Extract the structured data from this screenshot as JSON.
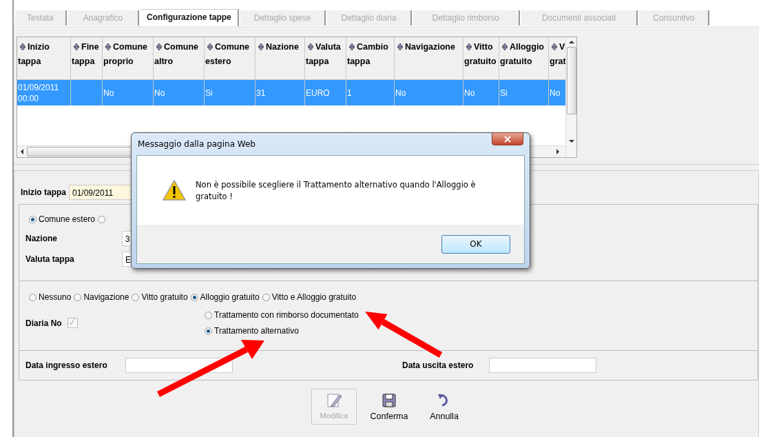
{
  "tabs": [
    {
      "label": "Testata",
      "selected": false
    },
    {
      "label": "Anagrafico",
      "selected": false
    },
    {
      "label": "Configurazione tappe",
      "selected": true
    },
    {
      "label": "Dettaglio spese",
      "selected": false
    },
    {
      "label": "Dettaglio diaria",
      "selected": false
    },
    {
      "label": "Dettaglio rimborso",
      "selected": false
    },
    {
      "label": "Documenti associati",
      "selected": false
    },
    {
      "label": "Consuntivo",
      "selected": false
    }
  ],
  "table": {
    "columns": [
      "Inizio tappa",
      "Fine tappa",
      "Comune proprio",
      "Comune altro",
      "Comune estero",
      "Nazione",
      "Valuta tappa",
      "Cambio tappa",
      "Navigazione",
      "Vitto gratuito",
      "Alloggio gratuito",
      "V grat"
    ],
    "rows": [
      {
        "selected": true,
        "cells": [
          "01/09/2011 00:00",
          "",
          "No",
          "No",
          "Si",
          "31",
          "EURO",
          "1",
          "No",
          "No",
          "Si",
          "No"
        ]
      }
    ]
  },
  "form": {
    "inizio_tappa": {
      "label": "Inizio tappa",
      "value": "01/09/2011"
    },
    "location": [
      {
        "label": "Comune estero",
        "selected": true
      },
      {
        "selected": false
      }
    ],
    "nazione": {
      "label": "Nazione",
      "value": "3"
    },
    "valuta": {
      "label": "Valuta tappa",
      "value": "E"
    },
    "gratuito": [
      {
        "label": "Nessuno",
        "selected": false
      },
      {
        "label": "Navigazione",
        "selected": false
      },
      {
        "label": "Vitto gratuito",
        "selected": false
      },
      {
        "label": "Alloggio gratuito",
        "selected": true
      },
      {
        "label": "Vitto e Alloggio gratuito",
        "selected": false
      }
    ],
    "diaria": {
      "label": "Diaria No",
      "checked": true,
      "disabled": true
    },
    "trattamento": [
      {
        "label": "Trattamento con rimborso documentato",
        "selected": false
      },
      {
        "label": "Trattamento alternativo",
        "selected": true
      }
    ],
    "data_ingresso": {
      "label": "Data ingresso estero"
    },
    "data_uscita": {
      "label": "Data uscita estero"
    }
  },
  "buttons": [
    {
      "kind": "edit",
      "label": "Modifica",
      "disabled": true
    },
    {
      "kind": "save",
      "label": "Conferma",
      "disabled": false
    },
    {
      "kind": "undo",
      "label": "Annulla",
      "disabled": false
    }
  ],
  "dialog": {
    "title": "Messaggio dalla pagina Web",
    "message": "Non è possibile scegliere il Trattamento alternativo quando l'Alloggio è gratuito !",
    "button": "OK"
  }
}
